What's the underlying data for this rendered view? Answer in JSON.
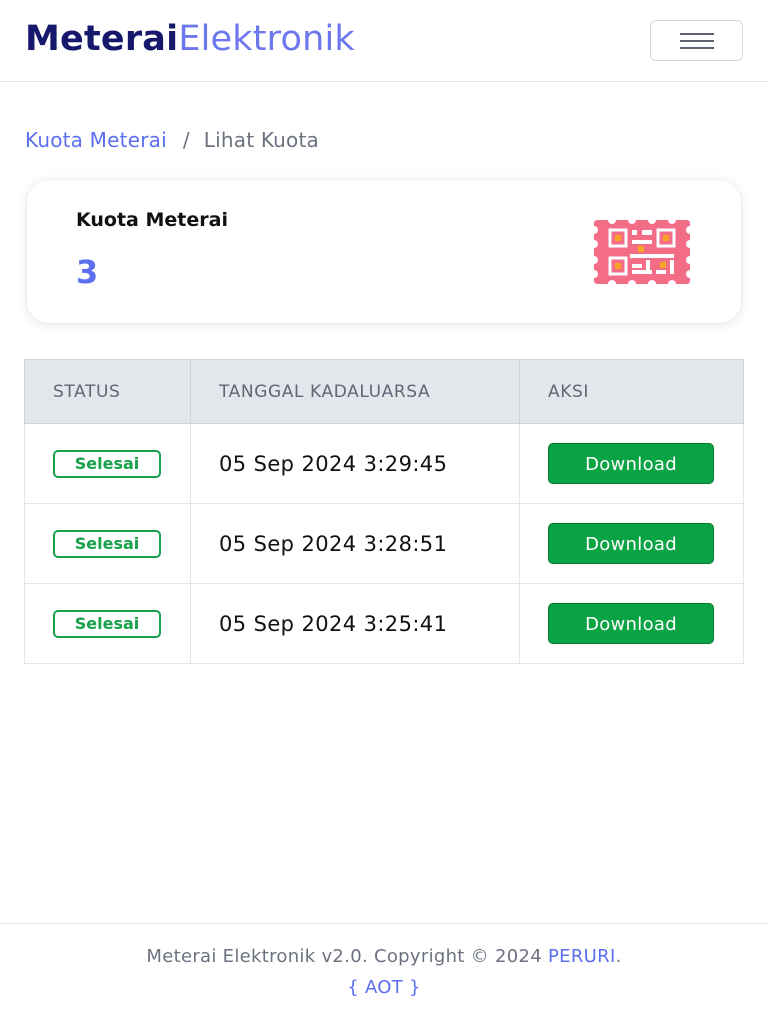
{
  "header": {
    "brand_bold": "Meterai",
    "brand_light": "Elektronik",
    "menu_icon": "hamburger-menu-icon"
  },
  "breadcrumb": {
    "parent": "Kuota Meterai",
    "separator": "/",
    "current": "Lihat Kuota"
  },
  "quota_card": {
    "label": "Kuota Meterai",
    "value": "3",
    "icon": "qr-stamp-icon"
  },
  "table": {
    "columns": [
      "STATUS",
      "TANGGAL KADALUARSA",
      "AKSI"
    ],
    "rows": [
      {
        "status": "Selesai",
        "date": "05 Sep 2024 3:29:45",
        "action": "Download"
      },
      {
        "status": "Selesai",
        "date": "05 Sep 2024 3:28:51",
        "action": "Download"
      },
      {
        "status": "Selesai",
        "date": "05 Sep 2024 3:25:41",
        "action": "Download"
      }
    ]
  },
  "footer": {
    "text": "Meterai Elektronik v2.0. Copyright © 2024 ",
    "link": "PERURI",
    "period": ".",
    "team": "{ AOT }"
  },
  "colors": {
    "brand_dark": "#15186b",
    "accent": "#5b6ef0",
    "success": "#16a34a",
    "button_green": "#0aa344",
    "stamp_pink": "#f26d85",
    "stamp_orange": "#f5a623"
  }
}
